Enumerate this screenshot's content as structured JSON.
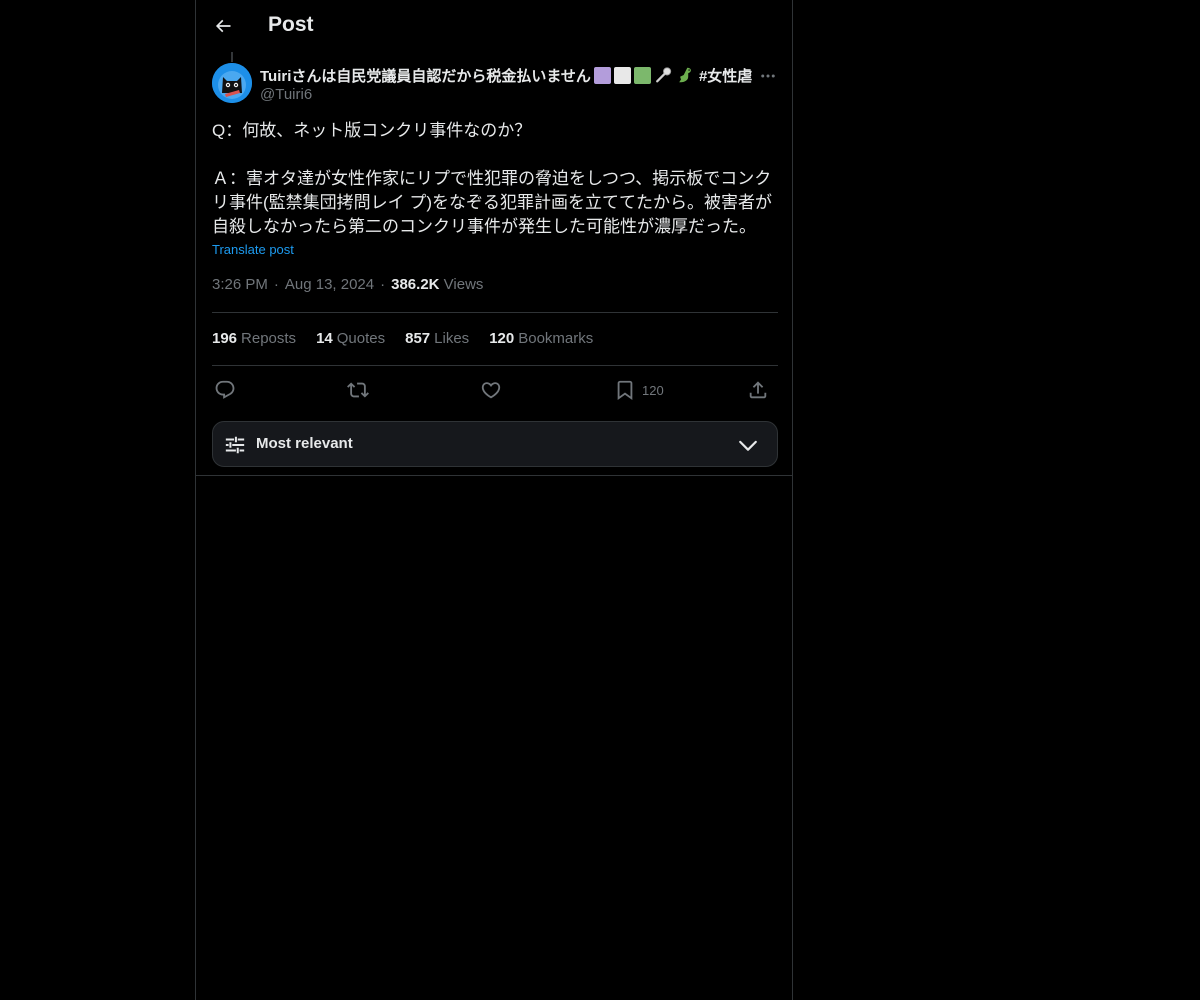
{
  "header": {
    "title": "Post"
  },
  "post": {
    "author": {
      "display_name": "Tuiriさんは自民党議員自認だから税金払いません",
      "emoji_colors": [
        "#b39ddb",
        "#e8e8e8",
        "#7cb86c"
      ],
      "hashtag": "#女性虐",
      "handle": "@Tuiri6",
      "avatar_icon": "cat-avatar-icon"
    },
    "body": "Q：何故、ネット版コンクリ事件なのか？\n\nＡ：害オタ達が女性作家にリプで性犯罪の脅迫をしつつ、掲示板でコンクリ事件(監禁集団拷問レイ プ)をなぞる犯罪計画を立ててたから。被害者が自殺しなかったら第二のコンクリ事件が発生した可能性が濃厚だった。",
    "translate_label": "Translate post",
    "time": "3:26 PM",
    "date": "Aug 13, 2024",
    "views_count": "386.2K",
    "views_label": "Views",
    "separator": "·"
  },
  "stats": [
    {
      "count": "196",
      "label": "Reposts"
    },
    {
      "count": "14",
      "label": "Quotes"
    },
    {
      "count": "857",
      "label": "Likes"
    },
    {
      "count": "120",
      "label": "Bookmarks"
    }
  ],
  "actions": {
    "bookmark_count": "120"
  },
  "sort": {
    "label": "Most relevant"
  },
  "colors": {
    "background": "#000000",
    "text": "#e7e9ea",
    "muted": "#71767b",
    "link": "#1d9bf0",
    "border": "#2f3336"
  }
}
